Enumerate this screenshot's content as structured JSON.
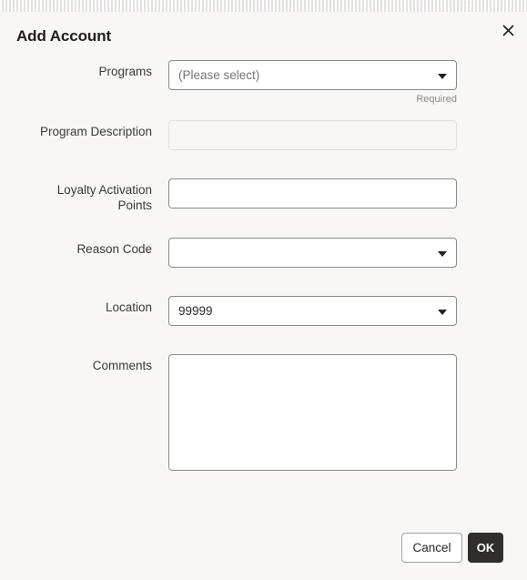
{
  "dialog": {
    "title": "Add Account",
    "close_icon": "close-icon"
  },
  "fields": [
    {
      "label": "Programs",
      "type": "select",
      "value": "(Please select)",
      "is_placeholder": true,
      "helper": "Required"
    },
    {
      "label": "Program Description",
      "type": "text",
      "value": "",
      "disabled": true
    },
    {
      "label": "Loyalty Activation Points",
      "label_line1": "Loyalty Activation",
      "label_line2": "Points",
      "type": "text",
      "value": ""
    },
    {
      "label": "Reason Code",
      "type": "select",
      "value": "",
      "is_placeholder": false
    },
    {
      "label": "Location",
      "type": "select",
      "value": "99999",
      "is_placeholder": false
    },
    {
      "label": "Comments",
      "type": "textarea",
      "value": ""
    }
  ],
  "footer": {
    "cancel_label": "Cancel",
    "ok_label": "OK"
  },
  "colors": {
    "background": "#f8f7f6",
    "text": "#2b2a28",
    "border": "#8b8a88",
    "disabled_border": "#e2e0dd",
    "primary_button": "#312d2a",
    "helper_text": "#8c8a87"
  }
}
